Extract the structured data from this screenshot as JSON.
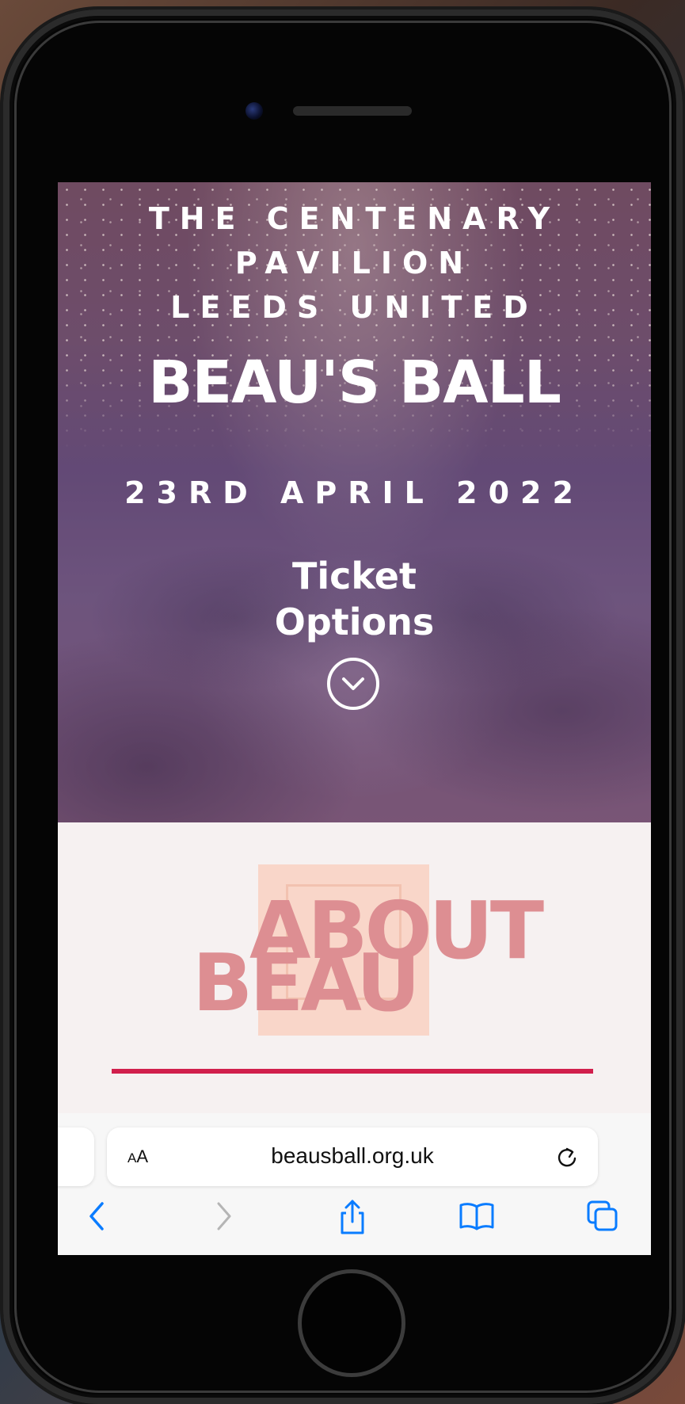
{
  "hero": {
    "venue_line1": "THE CENTENARY",
    "venue_line2": "PAVILION",
    "venue_line3": "LEEDS UNITED",
    "event_title": "BEAU'S BALL",
    "event_date": "23RD APRIL 2022",
    "ticket_line1": "Ticket",
    "ticket_line2": "Options",
    "scroll_icon": "chevron-down-circle-icon"
  },
  "about": {
    "heading_word1": "ABOUT",
    "heading_word2": "BEAU",
    "accent_color": "#dd8e92",
    "rule_color": "#d11f4c"
  },
  "browser": {
    "text_size_label_small": "A",
    "text_size_label_large": "A",
    "url": "beausball.org.uk",
    "reload_icon": "reload-icon",
    "toolbar": {
      "back_icon": "chevron-left-icon",
      "forward_icon": "chevron-right-icon",
      "share_icon": "share-icon",
      "bookmarks_icon": "book-icon",
      "tabs_icon": "tabs-icon"
    },
    "accent_color": "#0a7cff"
  }
}
